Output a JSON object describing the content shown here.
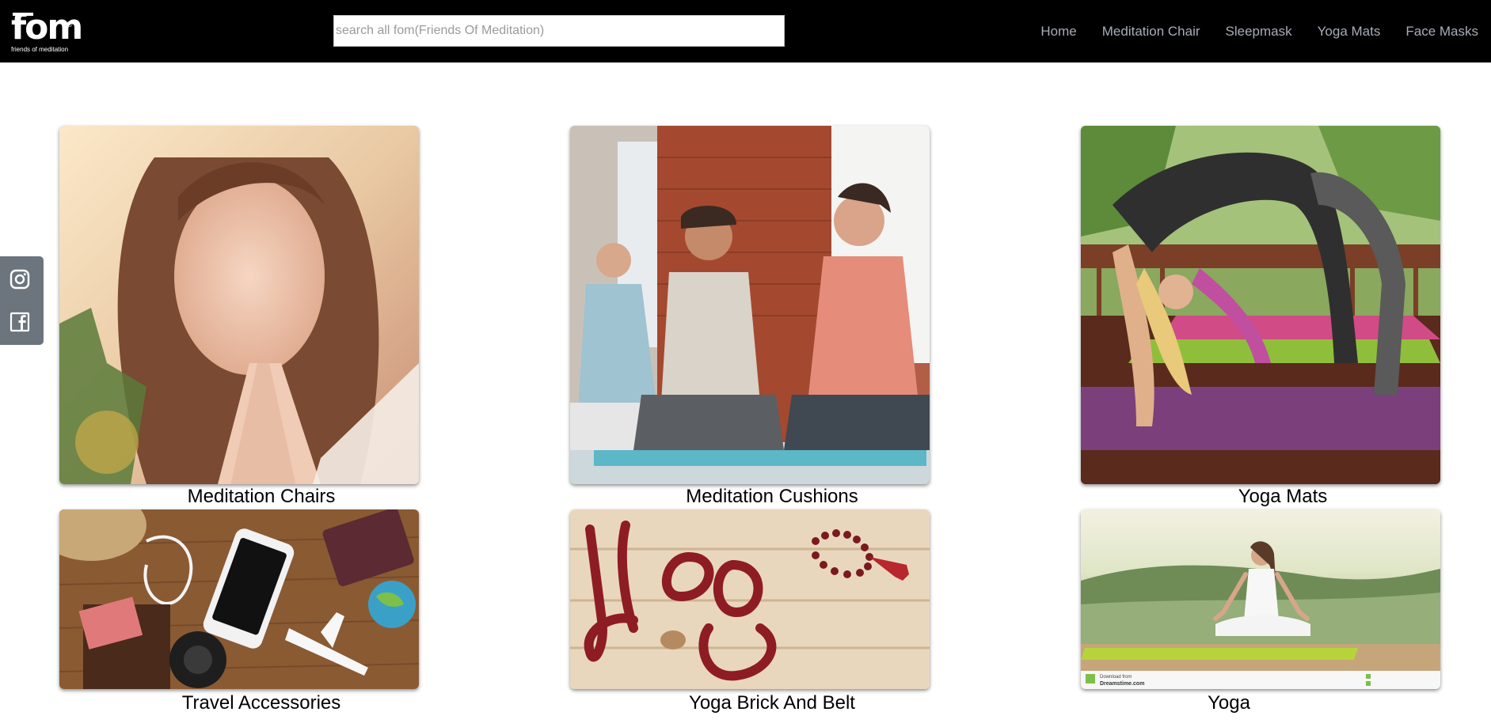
{
  "brand": {
    "wordmark": "fom",
    "registered": "®",
    "tagline": "friends of meditation"
  },
  "search": {
    "placeholder": "search all fom(Friends Of Meditation)",
    "value": ""
  },
  "nav": {
    "items": [
      "Home",
      "Meditation Chair",
      "Sleepmask",
      "Yoga Mats",
      "Face Masks"
    ]
  },
  "social": {
    "icons": [
      "instagram-icon",
      "facebook-icon"
    ]
  },
  "categories": [
    {
      "label": "Meditation Chairs"
    },
    {
      "label": "Meditation Cushions"
    },
    {
      "label": "Yoga Mats"
    },
    {
      "label": "Travel Accessories"
    },
    {
      "label": "Yoga Brick And Belt"
    },
    {
      "label": "Yoga"
    }
  ],
  "image_watermark": {
    "line1": "Download from",
    "line2": "Dreamstime.com"
  },
  "colors": {
    "header_bg": "#000000",
    "nav_link": "#a7adb7",
    "social_bg": "#6c757d"
  }
}
